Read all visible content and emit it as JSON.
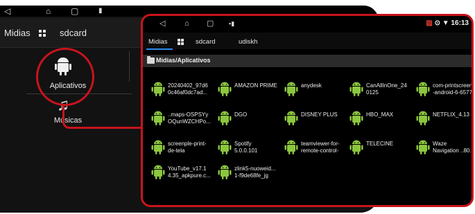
{
  "background": {
    "tabs": {
      "midias": "Midias",
      "sdcard": "sdcard"
    },
    "apps_label": "Aplicativos",
    "music_label": "Músicas"
  },
  "window": {
    "status": {
      "time": "16:13"
    },
    "tabs": {
      "midias": "Midias",
      "sdcard": "sdcard",
      "udiskh": "udiskh"
    },
    "path": "Midias/Aplicativos",
    "apps": [
      "20240402_97d6\n0c46af0dc7ad...",
      "AMAZON PRIME",
      "anydesk",
      "CanAllInOne_24\n0125",
      "com-printscreen\n-android-6-6577",
      "..maps-OSPSYy\nOQunWZCHPo...",
      "DGO",
      "DISNEY PLUS",
      "HBO_MAX",
      "NETFLIX_4.13",
      "screenple-print-\nde-tela",
      "Spotify\n5.0.0.101",
      "teamviewer-for-\nremote-control-",
      "TELECINE",
      "Waze\nNavigation ..80...",
      "YouTube_v17.1\n4.35_apkpure.c...",
      "zlink5-nuoweid...\n1-f9de68fe_jg"
    ],
    "android_green": "#8cc63f"
  },
  "accent": {
    "red": "#c8141c",
    "blue": "#2b8bf0"
  }
}
